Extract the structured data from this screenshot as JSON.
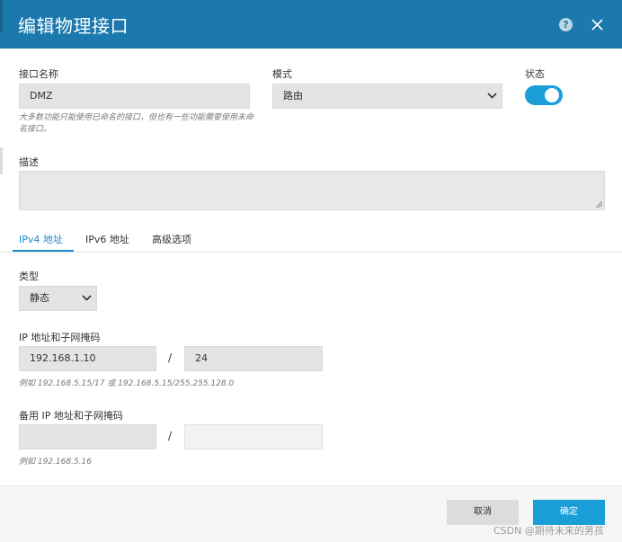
{
  "dialog": {
    "title": "编辑物理接口"
  },
  "form": {
    "interface_name": {
      "label": "接口名称",
      "value": "DMZ",
      "hint": "大多数功能只能使用已命名的接口，但也有一些功能需要使用未命名接口。"
    },
    "mode": {
      "label": "模式",
      "value": "路由"
    },
    "status": {
      "label": "状态",
      "on": true
    },
    "description": {
      "label": "描述",
      "value": ""
    }
  },
  "tabs": [
    {
      "label": "IPv4 地址",
      "active": true
    },
    {
      "label": "IPv6 地址",
      "active": false
    },
    {
      "label": "高级选项",
      "active": false
    }
  ],
  "ipv4": {
    "type": {
      "label": "类型",
      "value": "静态"
    },
    "ip_mask": {
      "label": "IP 地址和子网掩码",
      "ip": "192.168.1.10",
      "separator": "/",
      "mask": "24",
      "hint": "例如 192.168.5.15/17 或 192.168.5.15/255.255.128.0"
    },
    "standby": {
      "label": "备用 IP 地址和子网掩码",
      "ip": "",
      "separator": "/",
      "mask": "",
      "hint": "例如 192.168.5.16"
    }
  },
  "footer": {
    "cancel_label": "取消",
    "ok_label": "确定"
  },
  "watermark": "CSDN @期待未来的男孩",
  "colors": {
    "header": "#1b79ad",
    "accent": "#1a9ed8",
    "tab_active": "#1a8ccd"
  },
  "icons": {
    "help": "help-icon",
    "close": "close-icon",
    "select": "chevron-down-icon"
  }
}
